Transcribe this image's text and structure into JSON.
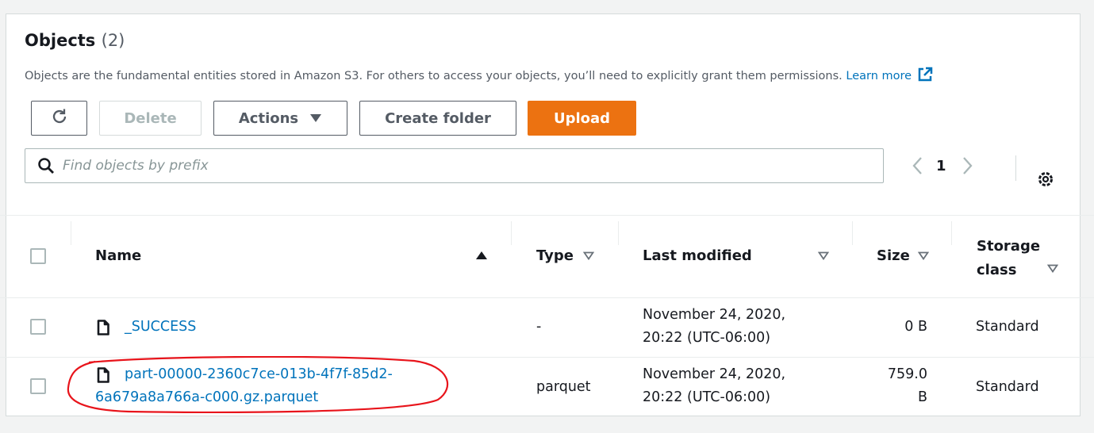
{
  "header": {
    "title": "Objects",
    "count": "(2)",
    "description": "Objects are the fundamental entities stored in Amazon S3. For others to access your objects, you’ll need to explicitly grant them permissions.",
    "learn_more": "Learn more"
  },
  "toolbar": {
    "delete_label": "Delete",
    "actions_label": "Actions",
    "create_folder_label": "Create folder",
    "upload_label": "Upload"
  },
  "search": {
    "placeholder": "Find objects by prefix"
  },
  "pagination": {
    "current_page": "1"
  },
  "table": {
    "columns": [
      "Name",
      "Type",
      "Last modified",
      "Size",
      "Storage class"
    ],
    "storage_class_line1": "Storage",
    "storage_class_line2": "class",
    "rows": [
      {
        "name": "_SUCCESS",
        "type": "-",
        "modified_line1": "November 24, 2020,",
        "modified_line2": "20:22 (UTC-06:00)",
        "size": "0 B",
        "storage_class": "Standard"
      },
      {
        "name_line1": "part-00000-2360c7ce-013b-4f7f-85d2-",
        "name_line2": "6a679a8a766a-c000.gz.parquet",
        "type": "parquet",
        "modified_line1": "November 24, 2020,",
        "modified_line2": "20:22 (UTC-06:00)",
        "size_line1": "759.0",
        "size_line2": "B",
        "storage_class": "Standard"
      }
    ]
  },
  "colors": {
    "accent": "#ec7211",
    "link": "#0073bb",
    "annotation": "#e8141b"
  }
}
